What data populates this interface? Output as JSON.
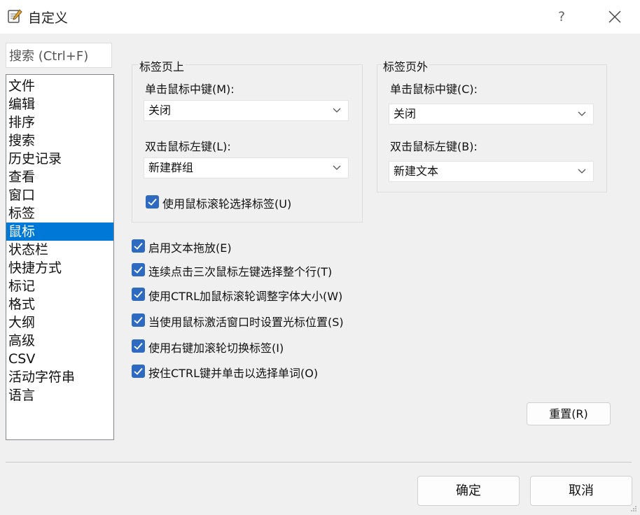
{
  "window": {
    "title": "自定义",
    "help_label": "?"
  },
  "search": {
    "placeholder": "搜索 (Ctrl+F)"
  },
  "nav": {
    "items": [
      "文件",
      "编辑",
      "排序",
      "搜索",
      "历史记录",
      "查看",
      "窗口",
      "标签",
      "鼠标",
      "状态栏",
      "快捷方式",
      "标记",
      "格式",
      "大纲",
      "高级",
      "CSV",
      "活动字符串",
      "语言"
    ],
    "selected": "鼠标"
  },
  "tab_on": {
    "legend": "标签页上",
    "middle_label": "单击鼠标中键(M):",
    "middle_value": "关闭",
    "double_left_label": "双击鼠标左键(L):",
    "double_left_value": "新建群组",
    "wheel_select_label": "使用鼠标滚轮选择标签(U)",
    "wheel_select_checked": true
  },
  "tab_out": {
    "legend": "标签页外",
    "middle_label": "单击鼠标中键(C):",
    "middle_value": "关闭",
    "double_left_label": "双击鼠标左键(B):",
    "double_left_value": "新建文本"
  },
  "options": [
    {
      "label": "启用文本拖放(E)",
      "checked": true
    },
    {
      "label": "连续点击三次鼠标左键选择整个行(T)",
      "checked": true
    },
    {
      "label": "使用CTRL加鼠标滚轮调整字体大小(W)",
      "checked": true
    },
    {
      "label": "当使用鼠标激活窗口时设置光标位置(S)",
      "checked": true
    },
    {
      "label": "使用右键加滚轮切换标签(I)",
      "checked": true
    },
    {
      "label": "按住CTRL键并单击以选择单词(O)",
      "checked": true
    }
  ],
  "buttons": {
    "reset": "重置(R)",
    "ok": "确定",
    "cancel": "取消"
  },
  "colors": {
    "accent": "#2f6ac1",
    "selection": "#0078d7"
  }
}
